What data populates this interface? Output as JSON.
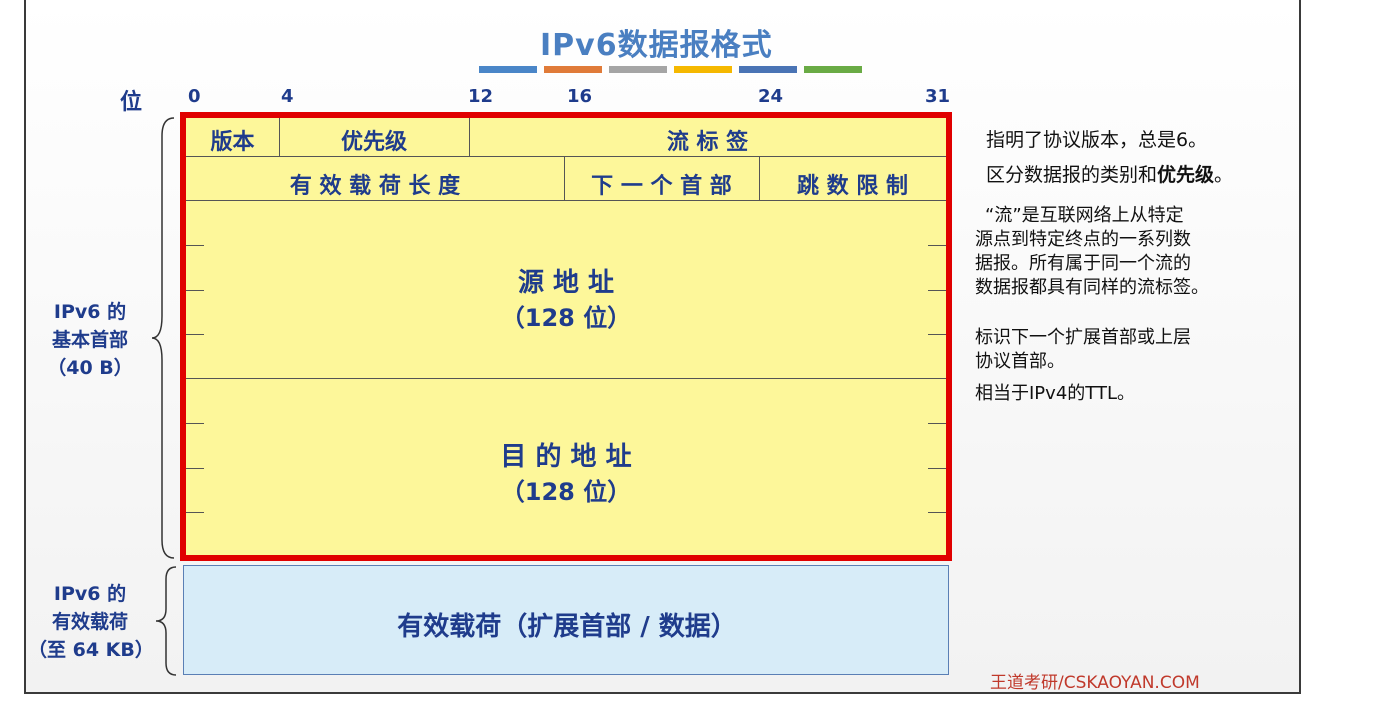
{
  "title": "IPv6数据报格式",
  "bit_axis": {
    "label": "位",
    "ticks": [
      "0",
      "4",
      "12",
      "16",
      "24",
      "31"
    ]
  },
  "header_fields": {
    "version": "版本",
    "priority": "优先级",
    "flow_label": "流 标 签",
    "payload_length": "有 效 载 荷 长 度",
    "next_header": "下 一 个 首 部",
    "hop_limit": "跳 数 限 制",
    "source_address": "源 地 址",
    "source_bits": "（128 位）",
    "dest_address": "目 的 地 址",
    "dest_bits": "（128 位）"
  },
  "payload": {
    "label": "有效载荷（扩展首部 / 数据）"
  },
  "side_labels": {
    "header": [
      "IPv6 的",
      "基本首部",
      "（40 B）"
    ],
    "payload": [
      "IPv6 的",
      "有效载荷",
      "（至 64 KB）"
    ]
  },
  "notes": {
    "version": "指明了协议版本，总是6。",
    "priority_prefix": "区分数据报的类别和",
    "priority_bold": "优先级",
    "priority_suffix": "。",
    "flow": [
      "“流”是互联网络上从特定",
      "源点到特定终点的一系列数",
      "据报。所有属于同一个流的",
      "数据报都具有同样的流标签。"
    ],
    "next_header": [
      "标识下一个扩展首部或上层",
      "协议首部。"
    ],
    "hop_limit": "相当于IPv4的TTL。"
  },
  "brand": "王道考研/CSKAOYAN.COM",
  "colors": {
    "accent_bars": [
      "#4a86c8",
      "#e07b39",
      "#a5a5a5",
      "#f5b800",
      "#4a74b5",
      "#6aab45"
    ],
    "header_fill": "#fdf79a",
    "header_border": "#e00000",
    "payload_fill": "#d7ecf8",
    "label_text": "#1f3c8c"
  }
}
